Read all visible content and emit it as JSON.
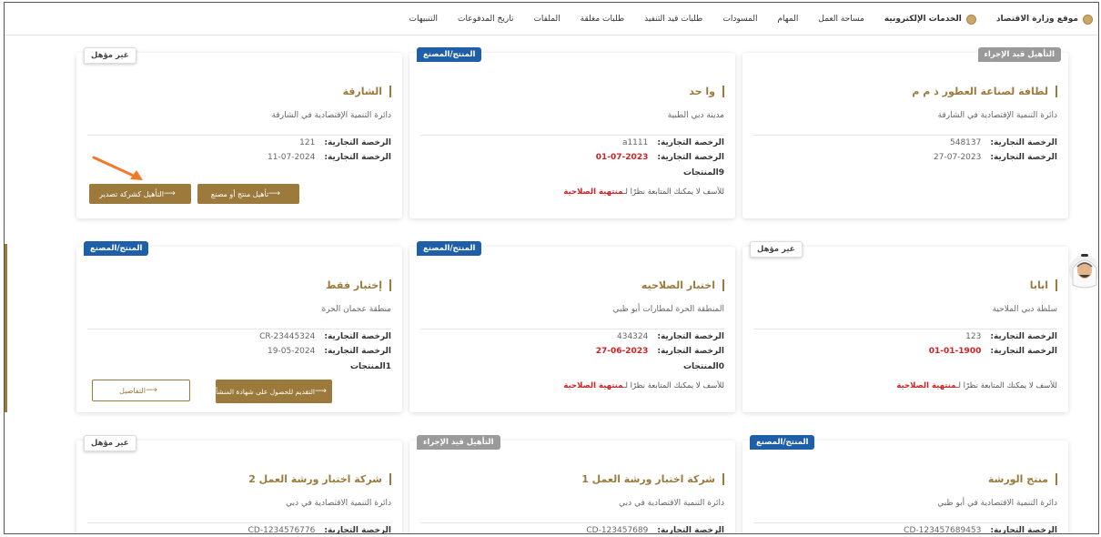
{
  "nav": {
    "items": [
      {
        "label": "موقع وزارة الاقتصاد",
        "icon": "globe-icon",
        "bold": true
      },
      {
        "label": "الخدمات الإلكترونية",
        "icon": "services-icon",
        "bold": true
      },
      {
        "label": "مساحة العمل"
      },
      {
        "label": "المهام"
      },
      {
        "label": "المسودات"
      },
      {
        "label": "طلبات قيد التنفيذ"
      },
      {
        "label": "طلبات مغلقة"
      },
      {
        "label": "الملفات"
      },
      {
        "label": "تاريخ المدفوعات"
      },
      {
        "label": "التنبيهات"
      }
    ]
  },
  "common": {
    "license_label": "الرخصة التجارية:",
    "expired_msg_prefix": "للأسف لا يمكنك المتابعة نظرًا لـ",
    "expired_msg_highlight": "منتهية الصلاحية"
  },
  "cards": [
    {
      "badge": "التأهيل قيد الإجراء",
      "title": "لطافة لصناعة العطور ذ م م",
      "sub": "دائرة التنمية الإقتصادية في الشارقة",
      "license": "548137",
      "date": "2023-07-27"
    },
    {
      "badge": "المنتج/المصنع",
      "title": "وا حد",
      "sub": "مدينة دبي الطبية",
      "license": "a1111",
      "date": "2023-07-01",
      "products": "9المنتجات"
    },
    {
      "badge": "غير مؤهل",
      "title": "الشارقة",
      "sub": "دائرة التنمية الإقتصادية في الشارقة",
      "license": "121",
      "date": "2024-07-11",
      "btn1": "تأهيل منتج أو مصنع",
      "btn2": "التأهيل كشركة تصدير"
    },
    {
      "badge": "غير مؤهل",
      "title": "ابابا",
      "sub": "سلطة دبي الملاحية",
      "license": "123",
      "date": "1900-01-01"
    },
    {
      "badge": "المنتج/المصنع",
      "title": "اختبار الصلاحيه",
      "sub": "المنطقة الحرة لمطارات أبو ظبي",
      "license": "434324",
      "date": "2023-06-27",
      "products": "0المنتجات"
    },
    {
      "badge": "المنتج/المصنع",
      "title": "إختبار فقط",
      "sub": "منطقة عجمان الحرة",
      "license": "CR-23445324",
      "date": "2024-05-19",
      "products": "1المنتجات",
      "btn1": "التقديم للحصول على شهادة المنشأ",
      "btn2": "التفاصيل"
    },
    {
      "badge": "المنتج/المصنع",
      "title": "منتج الورشة",
      "sub": "دائرة التنمية الاقتصادية في أبو ظبي",
      "license": "CD-123457689453"
    },
    {
      "badge": "التأهيل قيد الإجراء",
      "title": "شركة اختبار ورشة العمل 1",
      "sub": "دائرة التنمية الاقتصادية في دبي",
      "license": "CD-123457689"
    },
    {
      "badge": "غير مؤهل",
      "title": "شركة اختبار ورشة العمل 2",
      "sub": "دائرة التنمية الاقتصادية في دبي",
      "license": "CD-1234576776"
    }
  ],
  "colors": {
    "accent": "#9b7a3b",
    "blue": "#1f5fa8",
    "red": "#d42020",
    "gray": "#9a9a9a",
    "arrow": "#f07a2a"
  }
}
